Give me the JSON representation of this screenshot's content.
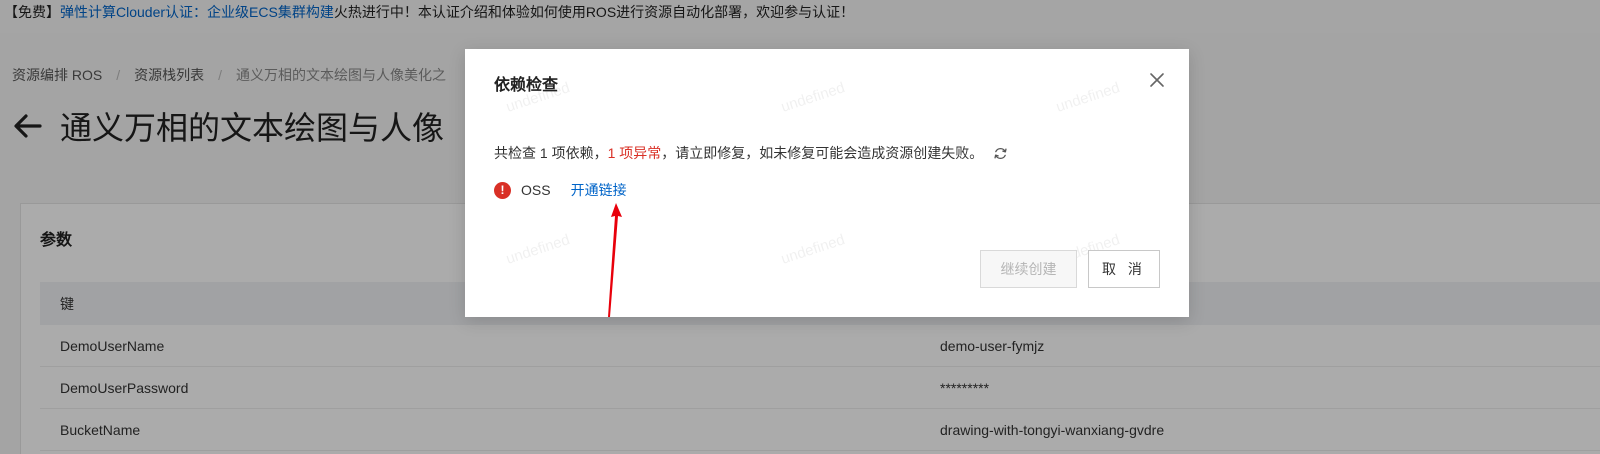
{
  "announcement": {
    "prefix": "【免费】",
    "link": "弹性计算Clouder认证：企业级ECS集群构建",
    "rest": "火热进行中！本认证介绍和体验如何使用ROS进行资源自动化部署，欢迎参与认证！"
  },
  "breadcrumb": [
    {
      "label": "资源编排 ROS"
    },
    {
      "label": "资源栈列表"
    },
    {
      "label": "通义万相的文本绘图与人像美化之"
    }
  ],
  "page": {
    "title": "通义万相的文本绘图与人像"
  },
  "params": {
    "heading": "参数",
    "table_header": "键",
    "rows": [
      {
        "key": "DemoUserName",
        "value": "demo-user-fymjz"
      },
      {
        "key": "DemoUserPassword",
        "value": "*********"
      },
      {
        "key": "BucketName",
        "value": "drawing-with-tongyi-wanxiang-gvdre"
      }
    ]
  },
  "modal": {
    "title": "依赖检查",
    "summary": {
      "part1": "共检查 1 项依赖，",
      "error": "1 项异常",
      "part2": "，请立即修复，如未修复可能会造成资源创建失败。"
    },
    "dependency": {
      "name": "OSS",
      "link_label": "开通链接",
      "status": "error"
    },
    "buttons": {
      "continue": "继续创建",
      "cancel": "取 消"
    },
    "watermark": "undefined"
  },
  "colors": {
    "link": "#0064c8",
    "error": "#d93026"
  }
}
